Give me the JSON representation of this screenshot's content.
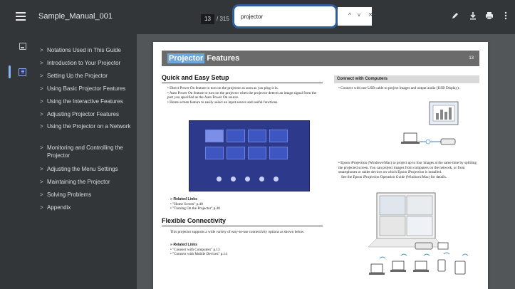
{
  "toolbar": {
    "title": "Sample_Manual_001",
    "page_current": "13",
    "page_total": "/ 315",
    "search_value": "projector",
    "find_prev": "^",
    "find_next": "v",
    "find_close": "×"
  },
  "sidebar": {
    "items": [
      {
        "label": "Notations Used in This Guide"
      },
      {
        "label": "Introduction to Your Projector"
      },
      {
        "label": "Setting Up the Projector"
      },
      {
        "label": "Using Basic Projector Features"
      },
      {
        "label": "Using the Interactive Features"
      },
      {
        "label": "Adjusting Projector Features"
      },
      {
        "label": "Using the Projector on a Network"
      },
      {
        "label": "Monitoring and Controlling the Projector"
      },
      {
        "label": "Adjusting the Menu Settings"
      },
      {
        "label": "Maintaining the Projector"
      },
      {
        "label": "Solving Problems"
      },
      {
        "label": "Appendix"
      }
    ],
    "chevron": ">"
  },
  "page": {
    "banner_highlight": "Projector",
    "banner_rest": " Features",
    "page_number": "13",
    "quick": {
      "title": "Quick and Easy Setup",
      "bullets": [
        "Direct Power On feature to turn on the projector as soon as you plug it in.",
        "Auto Power On feature to turn on the projector when the projector detects an image signal from the port you specified as the Auto Power On source.",
        "Home screen feature to easily select an input source and useful functions."
      ],
      "related_title": "Related Links",
      "related": [
        "\"Home Screen\" p.48",
        "\"Turning On the Projector\" p.48"
      ]
    },
    "flex": {
      "title": "Flexible Connectivity",
      "text": "This projector supports a wide variety of easy-to-use connectivity options as shown below.",
      "related_title": "Related Links",
      "related": [
        "\"Connect with Computers\" p.13",
        "\"Connect with Mobile Devices\" p.14"
      ]
    },
    "computers": {
      "title": "Connect with Computers",
      "bullet1": "Connect with one USB cable to project images and output audio (USB Display).",
      "bullet2": "Epson iProjection (Windows/Mac) to project up to four images at the same time by splitting the projected screen. You can project images from computers on the network, or from smartphones or tablet devices on which Epson iProjection is installed.",
      "see": "See the Epson iProjection Operation Guide (Windows/Mac) for details."
    }
  }
}
